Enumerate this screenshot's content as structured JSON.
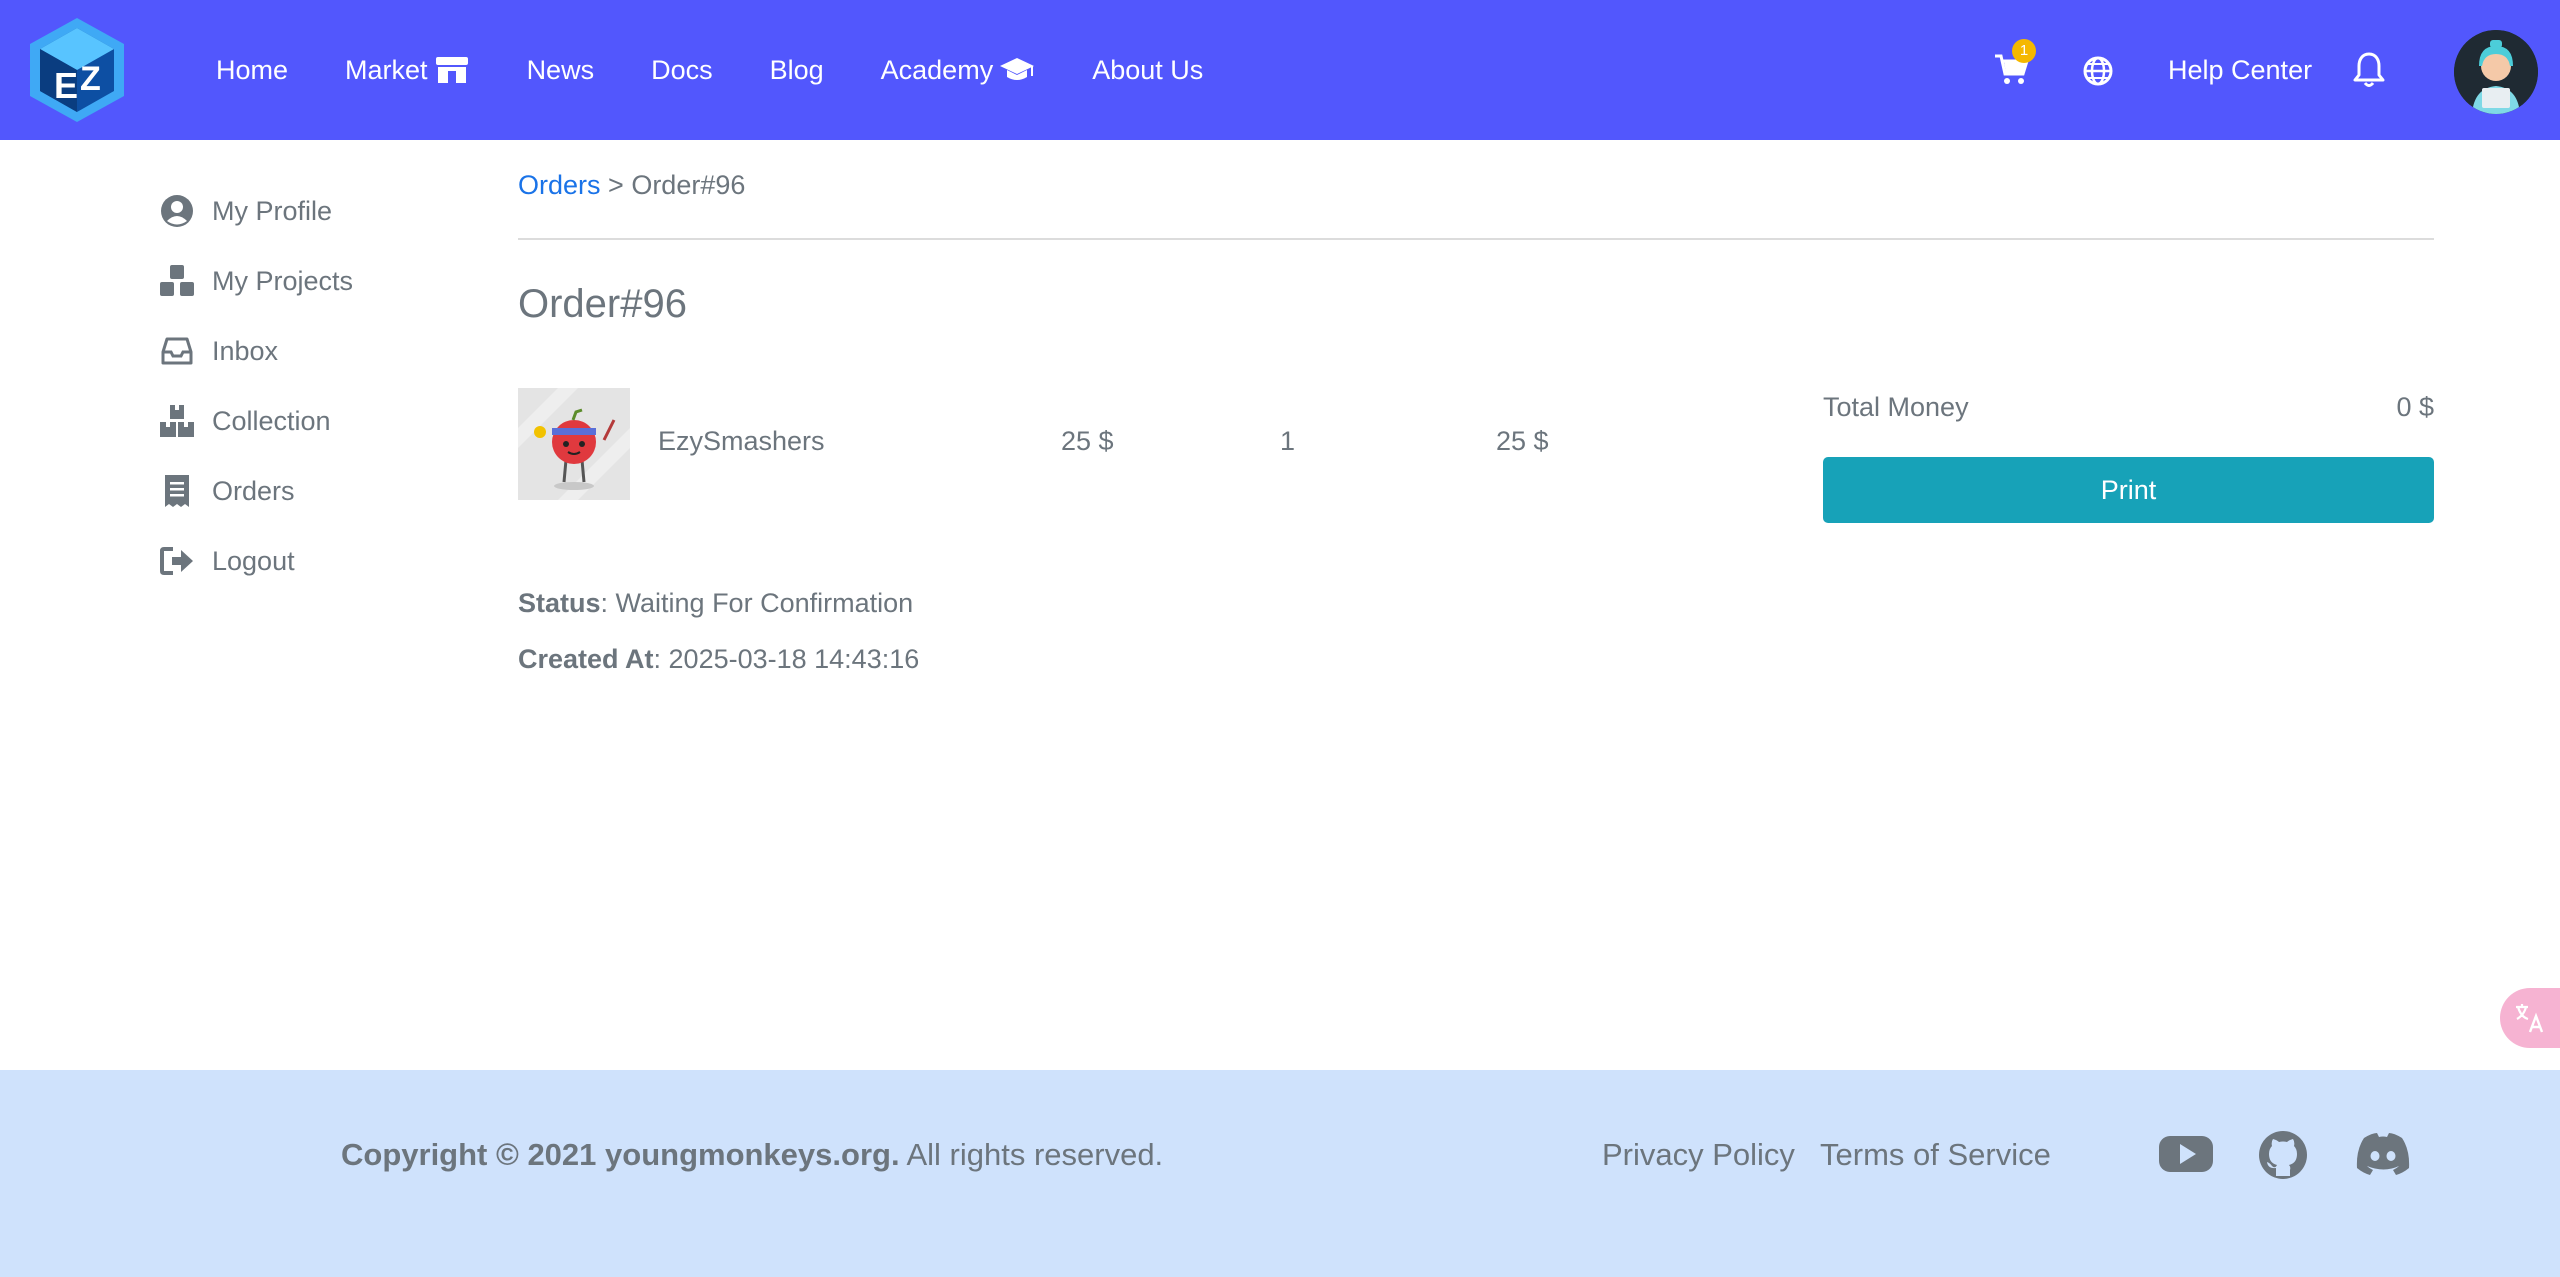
{
  "header": {
    "nav": [
      {
        "label": "Home",
        "icon": null
      },
      {
        "label": "Market",
        "icon": "store-icon"
      },
      {
        "label": "News",
        "icon": null
      },
      {
        "label": "Docs",
        "icon": null
      },
      {
        "label": "Blog",
        "icon": null
      },
      {
        "label": "Academy",
        "icon": "graduation-cap-icon"
      },
      {
        "label": "About Us",
        "icon": null
      }
    ],
    "cart_count": "1",
    "help_center": "Help Center",
    "brand_color": "#5257fd"
  },
  "sidebar": {
    "items": [
      {
        "label": "My Profile",
        "icon": "user-circle-icon"
      },
      {
        "label": "My Projects",
        "icon": "cubes-icon"
      },
      {
        "label": "Inbox",
        "icon": "inbox-icon"
      },
      {
        "label": "Collection",
        "icon": "boxes-icon"
      },
      {
        "label": "Orders",
        "icon": "receipt-icon"
      },
      {
        "label": "Logout",
        "icon": "logout-icon"
      }
    ]
  },
  "breadcrumb": {
    "parent": "Orders",
    "separator": " > ",
    "current": "Order#96"
  },
  "order": {
    "title": "Order#96",
    "item": {
      "name": "EzySmashers",
      "price": "25 $",
      "quantity": "1",
      "total": "25 $"
    },
    "total_money_label": "Total Money",
    "total_money_value": "0 $",
    "print_label": "Print",
    "status_label": "Status",
    "status_value": ": Waiting For Confirmation",
    "created_label": "Created At",
    "created_value": ": 2025-03-18 14:43:16",
    "accent_color": "#17a2b8"
  },
  "footer": {
    "copyright_bold": "Copyright © 2021 youngmonkeys.org.",
    "copyright_rest": " All rights reserved.",
    "privacy": "Privacy Policy",
    "terms": "Terms of Service",
    "social": [
      "youtube-icon",
      "github-icon",
      "discord-icon"
    ],
    "background": "#cfe2fc"
  }
}
